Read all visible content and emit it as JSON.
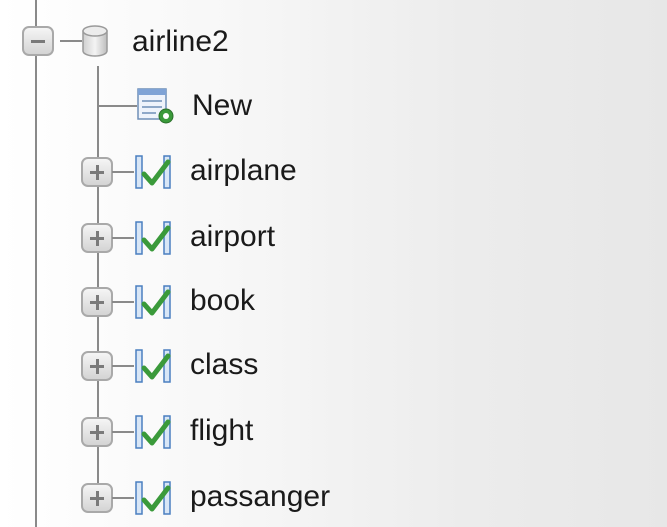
{
  "tree": {
    "database": {
      "label": "airline2",
      "expanded": true,
      "icon": "database-icon"
    },
    "new_item": {
      "label": "New",
      "icon": "new-table-icon"
    },
    "tables": [
      {
        "label": "airplane",
        "icon": "table-icon"
      },
      {
        "label": "airport",
        "icon": "table-icon"
      },
      {
        "label": "book",
        "icon": "table-icon"
      },
      {
        "label": "class",
        "icon": "table-icon"
      },
      {
        "label": "flight",
        "icon": "table-icon"
      },
      {
        "label": "passanger",
        "icon": "table-icon"
      }
    ]
  },
  "colors": {
    "line": "#8a8a8a",
    "table_icon_green": "#3a9a3a",
    "table_icon_blue": "#4a7fc0",
    "text": "#1a1a1a"
  }
}
